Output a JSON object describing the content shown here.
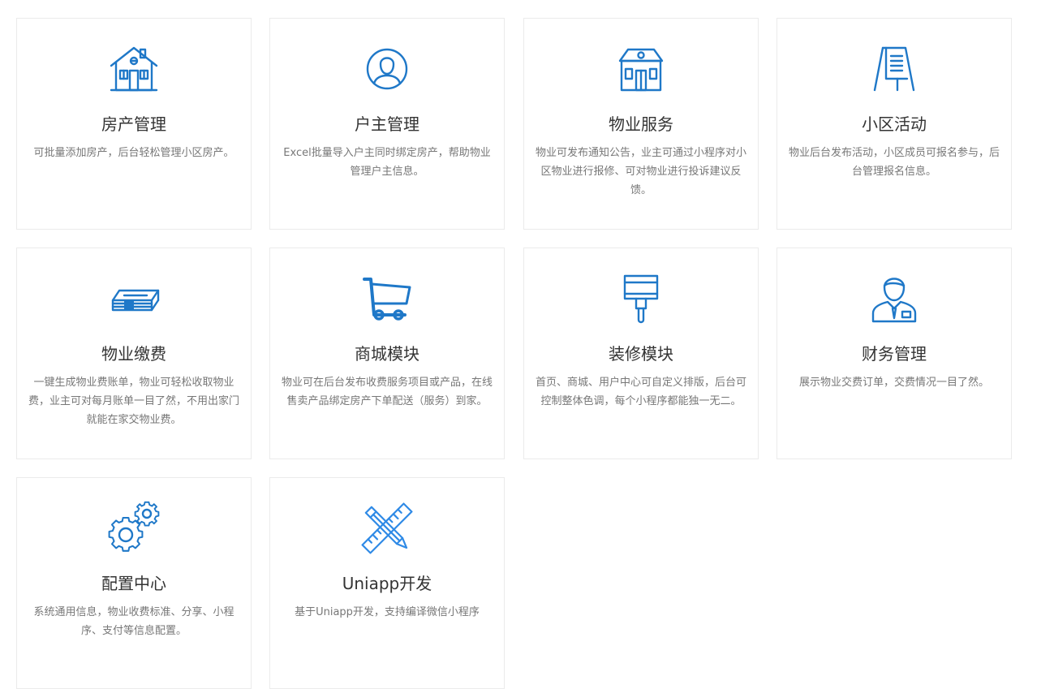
{
  "cards": [
    {
      "icon": "house-icon",
      "title": "房产管理",
      "desc": "可批量添加房产，后台轻松管理小区房产。"
    },
    {
      "icon": "user-icon",
      "title": "户主管理",
      "desc": "Excel批量导入户主同时绑定房产，帮助物业管理户主信息。"
    },
    {
      "icon": "building-icon",
      "title": "物业服务",
      "desc": "物业可发布通知公告，业主可通过小程序对小区物业进行报修、可对物业进行投诉建议反馈。"
    },
    {
      "icon": "easel-icon",
      "title": "小区活动",
      "desc": "物业后台发布活动，小区成员可报名参与，后台管理报名信息。"
    },
    {
      "icon": "money-icon",
      "title": "物业缴费",
      "desc": "一键生成物业费账单，物业可轻松收取物业费，业主可对每月账单一目了然，不用出家门就能在家交物业费。"
    },
    {
      "icon": "cart-icon",
      "title": "商城模块",
      "desc": "物业可在后台发布收费服务项目或产品，在线售卖产品绑定房产下单配送（服务）到家。"
    },
    {
      "icon": "paint-brush-icon",
      "title": "装修模块",
      "desc": "首页、商城、用户中心可自定义排版，后台可控制整体色调，每个小程序都能独一无二。"
    },
    {
      "icon": "staff-icon",
      "title": "财务管理",
      "desc": "展示物业交费订单，交费情况一目了然。"
    },
    {
      "icon": "gears-icon",
      "title": "配置中心",
      "desc": "系统通用信息，物业收费标准、分享、小程序、支付等信息配置。"
    },
    {
      "icon": "ruler-pencil-icon",
      "title": "Uniapp开发",
      "desc": "基于Uniapp开发，支持编译微信小程序"
    }
  ]
}
